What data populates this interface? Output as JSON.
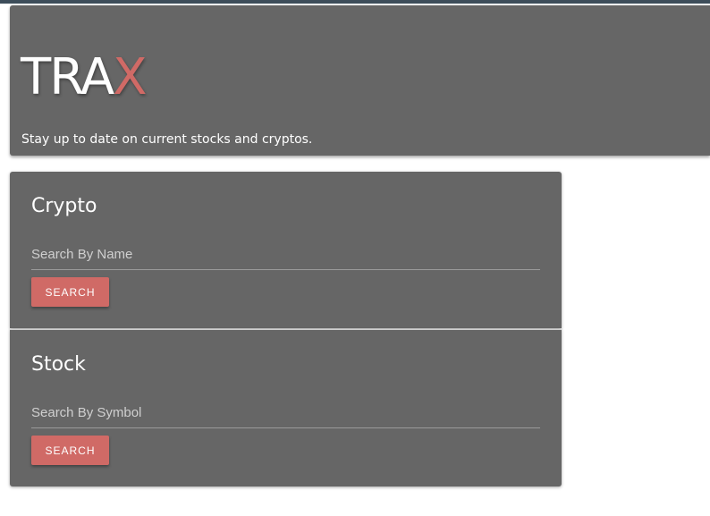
{
  "header": {
    "brand_main": "TRA",
    "brand_accent": "X",
    "tagline": "Stay up to date on current stocks and cryptos."
  },
  "crypto": {
    "title": "Crypto",
    "placeholder": "Search By Name",
    "button_label": "SEARCH"
  },
  "stock": {
    "title": "Stock",
    "placeholder": "Search By Symbol",
    "button_label": "SEARCH"
  },
  "colors": {
    "panel": "#666666",
    "accent": "#d06a66",
    "topbar": "#3d4d5a"
  }
}
